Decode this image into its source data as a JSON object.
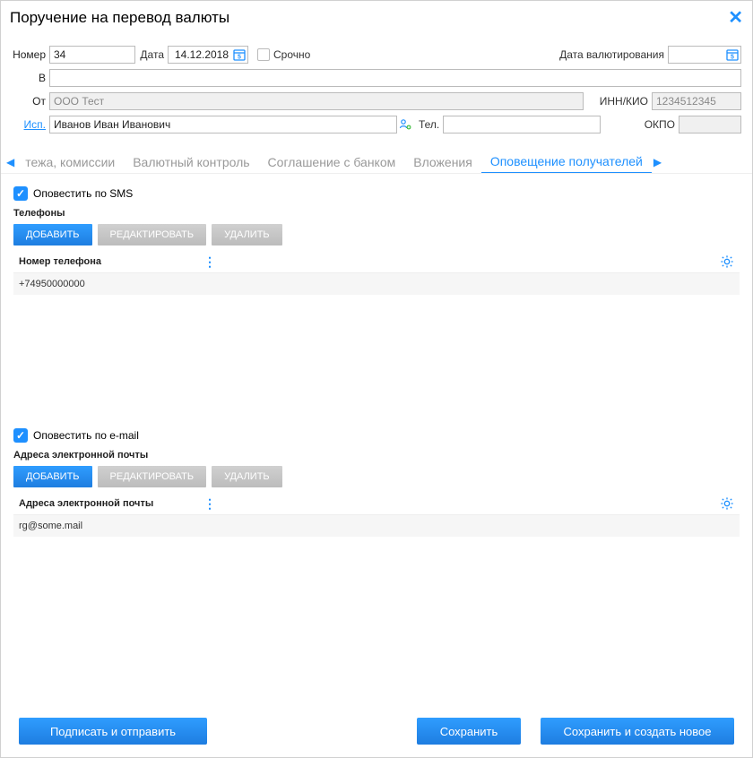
{
  "title": "Поручение на перевод валюты",
  "header": {
    "number_label": "Номер",
    "number_value": "34",
    "date_label": "Дата",
    "date_value": "14.12.2018",
    "urgent_label": "Срочно",
    "value_date_label": "Дата валютирования",
    "value_date_value": "",
    "to_label": "В",
    "to_value": "",
    "from_label": "От",
    "from_value": "ООО Тест",
    "inn_label": "ИНН/КИО",
    "inn_value": "1234512345",
    "okpo_label": "ОКПО",
    "okpo_value": "",
    "exec_label": "Исп.",
    "exec_value": "Иванов Иван Иванович",
    "tel_label": "Тел.",
    "tel_value": ""
  },
  "tabs": {
    "partial": "тежа, комиссии",
    "t1": "Валютный контроль",
    "t2": "Соглашение с банком",
    "t3": "Вложения",
    "t4": "Оповещение получателей"
  },
  "sms": {
    "checkbox": "Оповестить по SMS",
    "subtitle": "Телефоны",
    "add": "ДОБАВИТЬ",
    "edit": "РЕДАКТИРОВАТЬ",
    "del": "УДАЛИТЬ",
    "col": "Номер телефона",
    "rows": [
      "+74950000000"
    ]
  },
  "email": {
    "checkbox": "Оповестить по e-mail",
    "subtitle": "Адреса электронной почты",
    "add": "ДОБАВИТЬ",
    "edit": "РЕДАКТИРОВАТЬ",
    "del": "УДАЛИТЬ",
    "col": "Адреса электронной почты",
    "rows": [
      "rg@some.mail"
    ]
  },
  "footer": {
    "sign_send": "Подписать и отправить",
    "save": "Сохранить",
    "save_new": "Сохранить и создать новое"
  }
}
